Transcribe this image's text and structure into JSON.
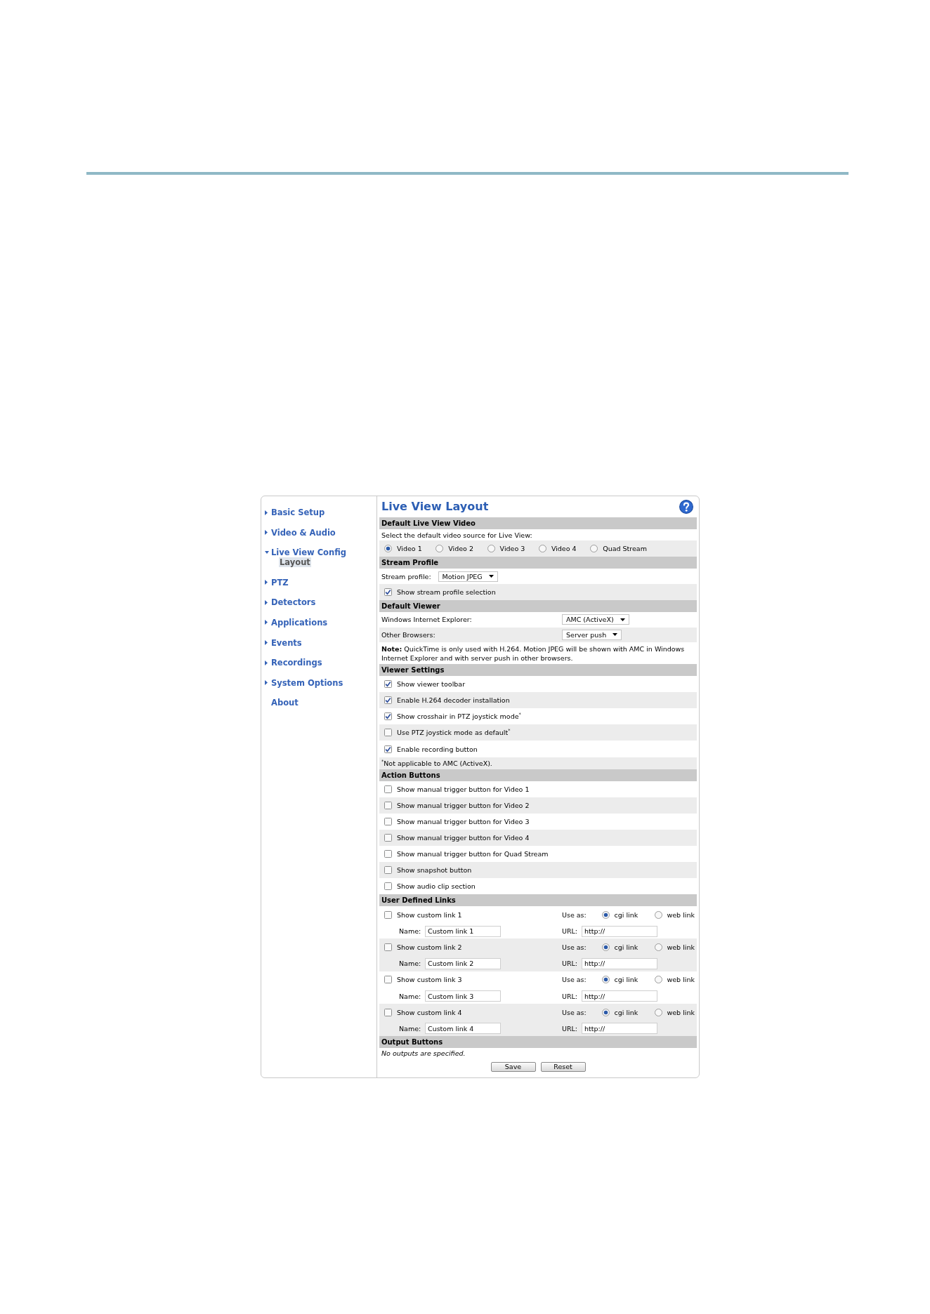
{
  "sidebar": {
    "items": [
      {
        "kind": "group",
        "label": "Basic Setup",
        "expanded": false,
        "selected": false
      },
      {
        "kind": "group",
        "label": "Video & Audio",
        "expanded": false,
        "selected": false
      },
      {
        "kind": "group",
        "label": "Live View Config",
        "expanded": true,
        "selected": false,
        "children": [
          {
            "label": "Layout",
            "selected": true
          }
        ]
      },
      {
        "kind": "group",
        "label": "PTZ",
        "expanded": false,
        "selected": false
      },
      {
        "kind": "group",
        "label": "Detectors",
        "expanded": false,
        "selected": false
      },
      {
        "kind": "group",
        "label": "Applications",
        "expanded": false,
        "selected": false
      },
      {
        "kind": "group",
        "label": "Events",
        "expanded": false,
        "selected": false
      },
      {
        "kind": "group",
        "label": "Recordings",
        "expanded": false,
        "selected": false
      },
      {
        "kind": "group",
        "label": "System Options",
        "expanded": false,
        "selected": false
      },
      {
        "kind": "link",
        "label": "About",
        "selected": false
      }
    ]
  },
  "content": {
    "title": "Live View Layout",
    "sections": [
      {
        "title": "Default Live View Video",
        "rows": [
          {
            "kind": "text",
            "text": "Select the default video source for Live View:"
          },
          {
            "kind": "radios",
            "options": [
              {
                "label": "Video 1",
                "selected": true
              },
              {
                "label": "Video 2",
                "selected": false
              },
              {
                "label": "Video 3",
                "selected": false
              },
              {
                "label": "Video 4",
                "selected": false
              },
              {
                "label": "Quad Stream",
                "selected": false
              }
            ]
          }
        ]
      },
      {
        "title": "Stream Profile",
        "rows": [
          {
            "kind": "select",
            "label": "Stream profile:",
            "value": "Motion JPEG"
          },
          {
            "kind": "checkbox",
            "label": "Show stream profile selection",
            "checked": true
          }
        ]
      },
      {
        "title": "Default Viewer",
        "rows": [
          {
            "kind": "field_select",
            "label": "Windows Internet Explorer:",
            "value": "AMC (ActiveX)"
          },
          {
            "kind": "field_select",
            "label": "Other Browsers:",
            "value": "Server push"
          },
          {
            "kind": "note",
            "text": "**Note:** QuickTime is only used with H.264. Motion JPEG will be shown with AMC in Windows Internet Explorer and with server push in other browsers."
          }
        ]
      },
      {
        "title": "Viewer Settings",
        "rows": [
          {
            "kind": "checkbox",
            "label": "Show viewer toolbar",
            "checked": true
          },
          {
            "kind": "checkbox",
            "label": "Enable H.264 decoder installation",
            "checked": true
          },
          {
            "kind": "checkbox",
            "label": "Show crosshair in PTZ joystick mode$^{*}$",
            "checked": true
          },
          {
            "kind": "checkbox",
            "label": "Use PTZ joystick mode as default$^{*}$",
            "checked": false
          },
          {
            "kind": "checkbox",
            "label": "Enable recording button",
            "checked": true
          },
          {
            "kind": "footnote",
            "text": "$^{*}$Not applicable to AMC (ActiveX)."
          }
        ]
      },
      {
        "title": "Action Buttons",
        "rows": [
          {
            "kind": "checkbox",
            "label": "Show manual trigger button for Video 1",
            "checked": false
          },
          {
            "kind": "checkbox",
            "label": "Show manual trigger button for Video 2",
            "checked": false
          },
          {
            "kind": "checkbox",
            "label": "Show manual trigger button for Video 3",
            "checked": false
          },
          {
            "kind": "checkbox",
            "label": "Show manual trigger button for Video 4",
            "checked": false
          },
          {
            "kind": "checkbox",
            "label": "Show manual trigger button for Quad Stream",
            "checked": false
          },
          {
            "kind": "checkbox",
            "label": "Show snapshot button",
            "checked": false
          },
          {
            "kind": "checkbox",
            "label": "Show audio clip section",
            "checked": false
          }
        ]
      },
      {
        "title": "User Defined Links",
        "rows": [
          {
            "kind": "custom_link",
            "label": "Show custom link 1",
            "checked": false,
            "use_as_label": "Use as:",
            "options": [
              {
                "label": "cgi link",
                "selected": true
              },
              {
                "label": "web link",
                "selected": false
              }
            ],
            "name_label": "Name:",
            "name": "Custom link 1",
            "url_label": "URL:",
            "url": "http://"
          },
          {
            "kind": "custom_link",
            "label": "Show custom link 2",
            "checked": false,
            "use_as_label": "Use as:",
            "options": [
              {
                "label": "cgi link",
                "selected": true
              },
              {
                "label": "web link",
                "selected": false
              }
            ],
            "name_label": "Name:",
            "name": "Custom link 2",
            "url_label": "URL:",
            "url": "http://"
          },
          {
            "kind": "custom_link",
            "label": "Show custom link 3",
            "checked": false,
            "use_as_label": "Use as:",
            "options": [
              {
                "label": "cgi link",
                "selected": true
              },
              {
                "label": "web link",
                "selected": false
              }
            ],
            "name_label": "Name:",
            "name": "Custom link 3",
            "url_label": "URL:",
            "url": "http://"
          },
          {
            "kind": "custom_link",
            "label": "Show custom link 4",
            "checked": false,
            "use_as_label": "Use as:",
            "options": [
              {
                "label": "cgi link",
                "selected": true
              },
              {
                "label": "web link",
                "selected": false
              }
            ],
            "name_label": "Name:",
            "name": "Custom link 4",
            "url_label": "URL:",
            "url": "http://"
          }
        ]
      },
      {
        "title": "Output Buttons",
        "rows": [
          {
            "kind": "empty",
            "text": "No outputs are specified."
          }
        ]
      }
    ],
    "buttons": [
      "Save",
      "Reset"
    ]
  }
}
